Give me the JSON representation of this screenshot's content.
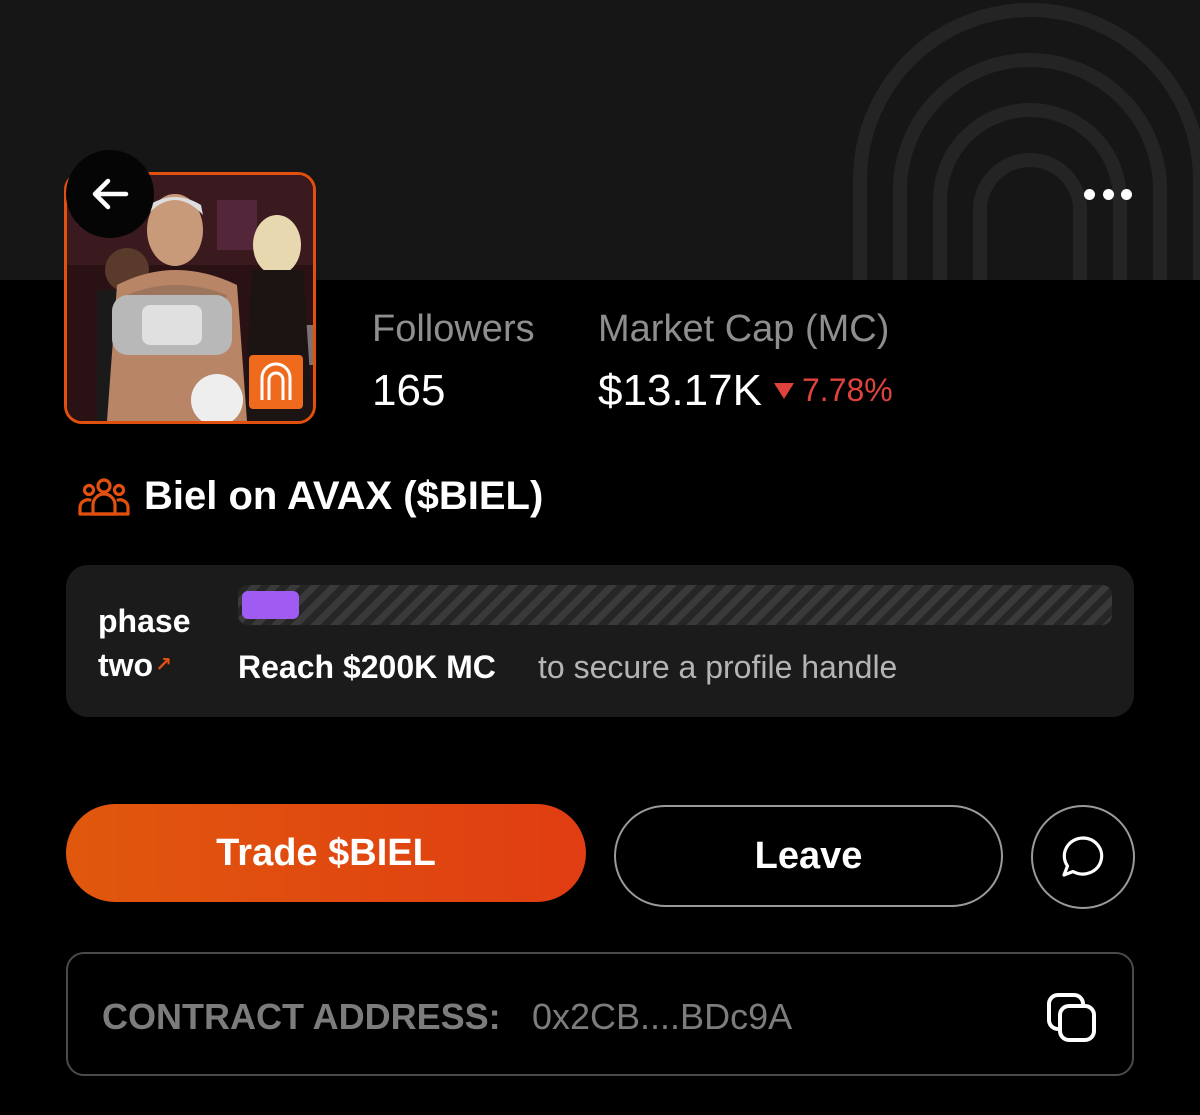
{
  "header": {
    "back_icon": "arrow-left-icon",
    "more_icon": "more-horizontal-icon"
  },
  "profile": {
    "avatar_icon": "profile-photo",
    "badge_icon": "arch-logo-icon",
    "followers_label": "Followers",
    "followers_value": "165",
    "market_cap_label": "Market Cap (MC)",
    "market_cap_value": "$13.17K",
    "change_value": "7.78%",
    "change_direction": "down",
    "change_color": "#e0433b"
  },
  "token": {
    "icon": "group-icon",
    "name": "Biel on AVAX ($BIEL)"
  },
  "phase": {
    "label_line1": "phase",
    "label_line2": "two",
    "label_arrow": "↗",
    "progress_fraction": 0.066,
    "progress_color": "#a05bf3",
    "goal_strong": "Reach $200K MC",
    "goal_rest": "to secure a profile handle"
  },
  "actions": {
    "trade_label": "Trade $BIEL",
    "leave_label": "Leave",
    "chat_icon": "chat-bubble-icon",
    "accent_color": "#e2500f"
  },
  "contract": {
    "label": "CONTRACT ADDRESS:",
    "value": "0x2CB....BDc9A",
    "copy_icon": "copy-icon"
  }
}
